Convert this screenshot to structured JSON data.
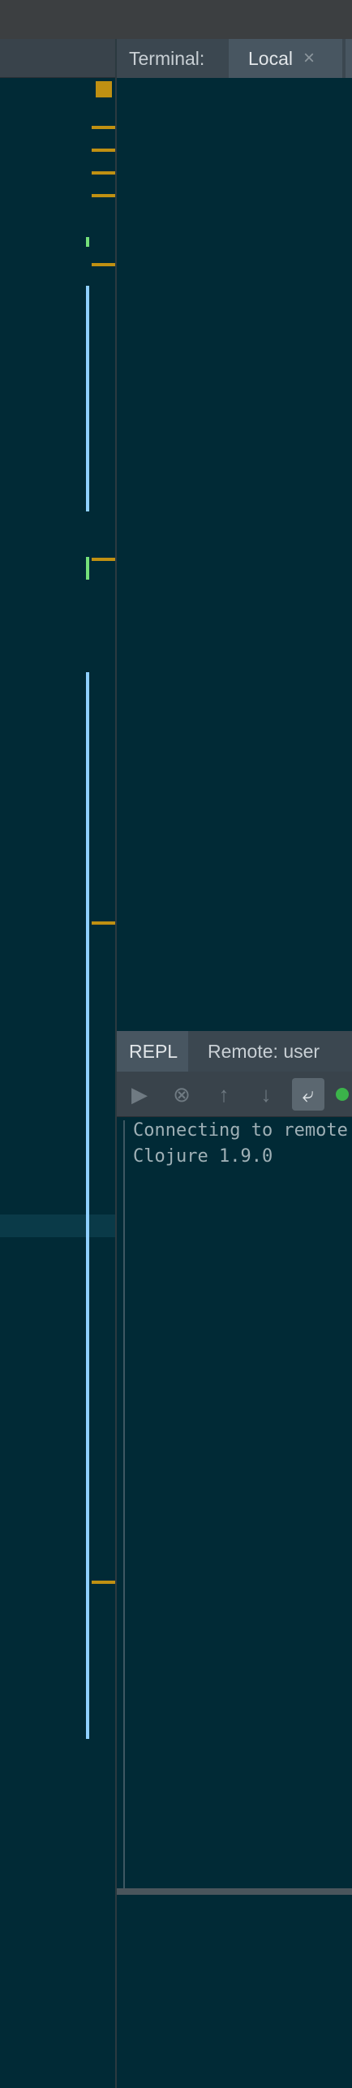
{
  "terminal": {
    "label": "Terminal:",
    "tab_local": "Local",
    "close_glyph": "×"
  },
  "repl": {
    "tab_label": "REPL",
    "remote_label": "Remote: user",
    "toolbar": {
      "run_icon": "▶",
      "stop_icon": "⊗",
      "history_up_icon": "↑",
      "history_down_icon": "↓",
      "soft_wrap_icon": "⤶"
    },
    "console_lines": [
      "Connecting to remote",
      "Clojure 1.9.0"
    ]
  },
  "colors": {
    "background": "#012a36",
    "marker_yellow": "#c09012",
    "change_blue": "#8fd0ff",
    "change_green": "#75e07a"
  }
}
